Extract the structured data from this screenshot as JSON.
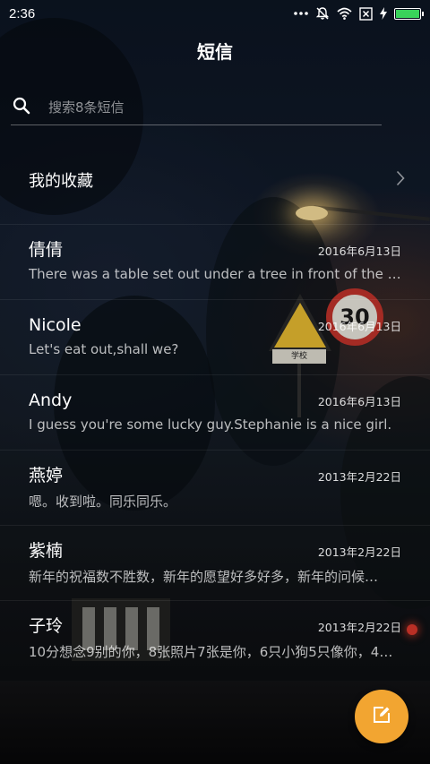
{
  "status_bar": {
    "time": "2:36",
    "icons": [
      "more-dots-icon",
      "mute-bell-icon",
      "wifi-icon",
      "sim-x-icon",
      "charging-icon",
      "battery-icon"
    ],
    "battery_color": "#39d35a"
  },
  "header": {
    "title": "短信"
  },
  "search": {
    "placeholder": "搜索8条短信",
    "value": ""
  },
  "favorites": {
    "label": "我的收藏"
  },
  "conversations": [
    {
      "name": "倩倩",
      "date": "2016年6月13日",
      "preview": "There was a table set out under a tree in front of the ho…"
    },
    {
      "name": "Nicole",
      "date": "2016年6月13日",
      "preview": "Let's eat out,shall we?"
    },
    {
      "name": "Andy",
      "date": "2016年6月13日",
      "preview": "I guess you're some lucky guy.Stephanie is a nice girl."
    },
    {
      "name": "燕婷",
      "date": "2013年2月22日",
      "preview": "嗯。收到啦。同乐同乐。"
    },
    {
      "name": "紫楠",
      "date": "2013年2月22日",
      "preview": "新年的祝福数不胜数，新年的愿望好多好多，新年的问候…"
    },
    {
      "name": "子玲",
      "date": "2013年2月22日",
      "preview": "10分想念9别的你，8张照片7张是你，6只小狗5只像你，4…"
    }
  ],
  "background": {
    "sign_text": "学校",
    "speed_limit": "30"
  },
  "fab": {
    "icon": "compose-icon",
    "color": "#f2a531"
  }
}
